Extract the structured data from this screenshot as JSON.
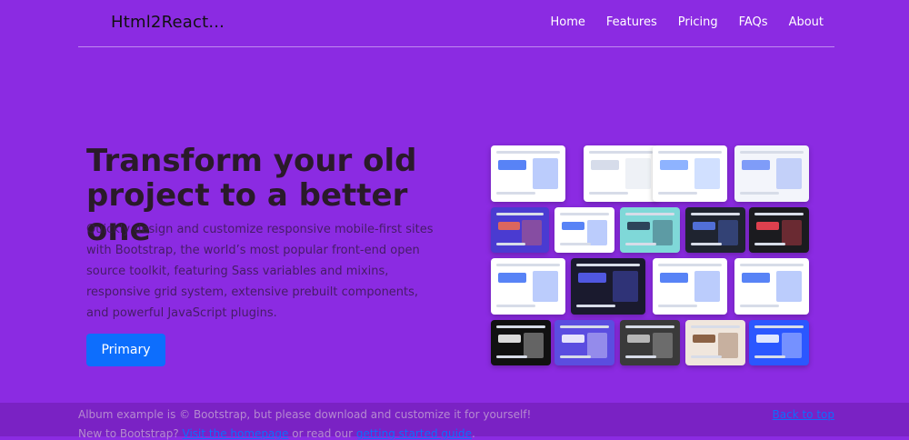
{
  "header": {
    "brand": "Html2React...",
    "nav": [
      "Home",
      "Features",
      "Pricing",
      "FAQs",
      "About"
    ]
  },
  "hero": {
    "title": "Transform your old project to a better one",
    "text": "Quickly design and customize responsive mobile-first sites with Bootstrap, the world’s most popular front-end open source toolkit, featuring Sass variables and mixins, responsive grid system, extensive prebuilt components, and powerful JavaScript plugins.",
    "button": "Primary"
  },
  "collage_tiles": [
    {
      "name": "template-tile-1",
      "bg": "#ffffff",
      "accent": "#3b6df5"
    },
    {
      "name": "template-tile-2",
      "bg": "#ffffff",
      "accent": "#cfd6e6"
    },
    {
      "name": "template-tile-3",
      "bg": "#ffffff",
      "accent": "#7aa6ff"
    },
    {
      "name": "template-tile-4",
      "bg": "#f3f5fb",
      "accent": "#6a8cf7"
    },
    {
      "name": "template-tile-5",
      "bg": "#4a3bd1",
      "accent": "#f56f4a"
    },
    {
      "name": "template-tile-6",
      "bg": "#ffffff",
      "accent": "#3b6df5"
    },
    {
      "name": "template-tile-7",
      "bg": "#7fd8d8",
      "accent": "#1f2a44"
    },
    {
      "name": "template-tile-8",
      "bg": "#1f2430",
      "accent": "#5a7cf5"
    },
    {
      "name": "template-tile-9",
      "bg": "#1b1b1f",
      "accent": "#ff4757"
    },
    {
      "name": "template-tile-10",
      "bg": "#ffffff",
      "accent": "#3b6df5"
    },
    {
      "name": "template-tile-11",
      "bg": "#1a1a2e",
      "accent": "#5a63ff"
    },
    {
      "name": "template-tile-12",
      "bg": "#ffffff",
      "accent": "#3b6df5"
    },
    {
      "name": "template-tile-13",
      "bg": "#ffffff",
      "accent": "#3b6df5"
    },
    {
      "name": "template-tile-14",
      "bg": "#111111",
      "accent": "#ffffff"
    },
    {
      "name": "template-tile-15",
      "bg": "#5b4de0",
      "accent": "#ffffff"
    },
    {
      "name": "template-tile-16",
      "bg": "#3a3a3a",
      "accent": "#cccccc"
    },
    {
      "name": "template-tile-17",
      "bg": "#f0e6dd",
      "accent": "#7a4a2a"
    },
    {
      "name": "template-tile-18",
      "bg": "#2b57ff",
      "accent": "#ffffff"
    },
    {
      "name": "template-tile-19",
      "bg": "#f06aa0",
      "accent": "#1a3a6a"
    }
  ],
  "footer": {
    "line1": "Album example is © Bootstrap, but please download and customize it for yourself!",
    "line2_prefix": "New to Bootstrap? ",
    "line2_link1": "Visit the homepage",
    "line2_mid": " or read our ",
    "line2_link2": "getting started guide",
    "line2_suffix": ".",
    "back_to_top": "Back to top"
  }
}
